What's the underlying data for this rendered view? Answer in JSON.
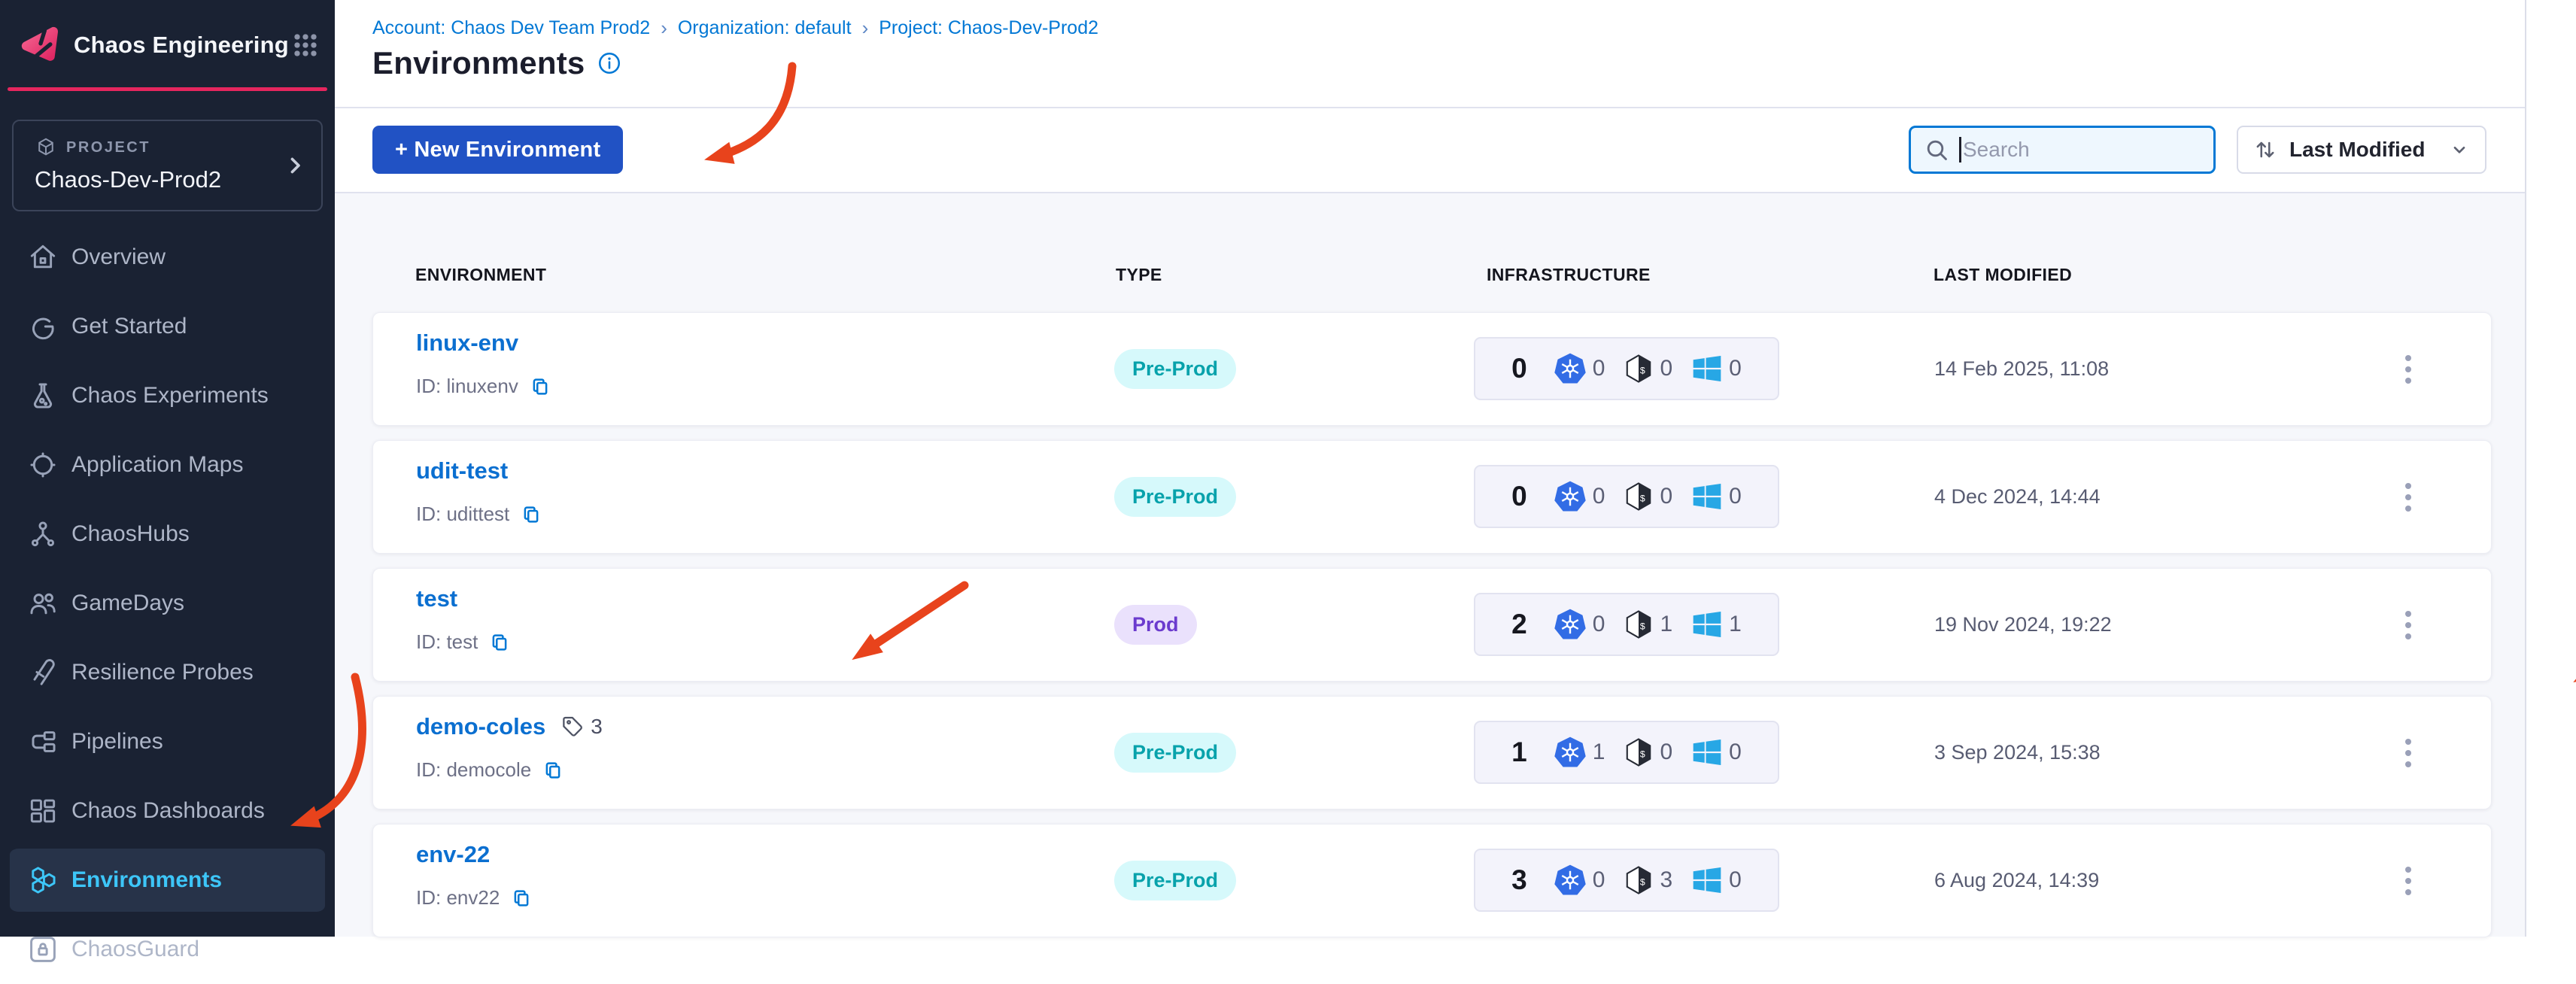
{
  "sidebar": {
    "brand": {
      "title": "Chaos Engineering"
    },
    "project": {
      "label": "PROJECT",
      "name": "Chaos-Dev-Prod2"
    },
    "items": [
      {
        "label": "Overview",
        "icon": "home"
      },
      {
        "label": "Get Started",
        "icon": "get-started"
      },
      {
        "label": "Chaos Experiments",
        "icon": "experiments"
      },
      {
        "label": "Application Maps",
        "icon": "application-maps"
      },
      {
        "label": "ChaosHubs",
        "icon": "chaoshubs"
      },
      {
        "label": "GameDays",
        "icon": "gamedays"
      },
      {
        "label": "Resilience Probes",
        "icon": "resilience-probes"
      },
      {
        "label": "Pipelines",
        "icon": "pipelines"
      },
      {
        "label": "Chaos Dashboards",
        "icon": "dashboards"
      },
      {
        "label": "Environments",
        "icon": "environments",
        "active": true
      },
      {
        "label": "ChaosGuard",
        "icon": "chaosguard"
      }
    ]
  },
  "breadcrumb": {
    "items": [
      "Account: Chaos Dev Team Prod2",
      "Organization: default",
      "Project: Chaos-Dev-Prod2"
    ],
    "separator": "›"
  },
  "page": {
    "title": "Environments"
  },
  "toolbar": {
    "new_button": "+ New Environment",
    "search_placeholder": "Search",
    "sort_label": "Last Modified"
  },
  "table": {
    "columns": [
      "ENVIRONMENT",
      "TYPE",
      "INFRASTRUCTURE",
      "LAST MODIFIED"
    ],
    "rows": [
      {
        "name": "linux-env",
        "id": "ID: linuxenv",
        "type": "Pre-Prod",
        "variant": "preprod",
        "total": "0",
        "k8s": "0",
        "linux": "0",
        "windows": "0",
        "modified": "14 Feb 2025, 11:08"
      },
      {
        "name": "udit-test",
        "id": "ID: udittest",
        "type": "Pre-Prod",
        "variant": "preprod",
        "total": "0",
        "k8s": "0",
        "linux": "0",
        "windows": "0",
        "modified": "4 Dec 2024, 14:44"
      },
      {
        "name": "test",
        "id": "ID: test",
        "type": "Prod",
        "variant": "prod",
        "total": "2",
        "k8s": "0",
        "linux": "1",
        "windows": "1",
        "modified": "19 Nov 2024, 19:22"
      },
      {
        "name": "demo-coles",
        "id": "ID: democole",
        "tag_count": "3",
        "type": "Pre-Prod",
        "variant": "preprod",
        "total": "1",
        "k8s": "1",
        "linux": "0",
        "windows": "0",
        "modified": "3 Sep 2024, 15:38"
      },
      {
        "name": "env-22",
        "id": "ID: env22",
        "type": "Pre-Prod",
        "variant": "preprod",
        "total": "3",
        "k8s": "0",
        "linux": "3",
        "windows": "0",
        "modified": "6 Aug 2024, 14:39"
      }
    ]
  },
  "colors": {
    "accent_pink": "#e5265e",
    "primary_blue": "#0278d5",
    "button_blue": "#2152c4",
    "sidebar_bg": "#1a2233",
    "active_link": "#3dc6f8",
    "preprod_text": "#07a2ab",
    "prod_text": "#6b3bce",
    "annotation_red": "#e8431c"
  }
}
